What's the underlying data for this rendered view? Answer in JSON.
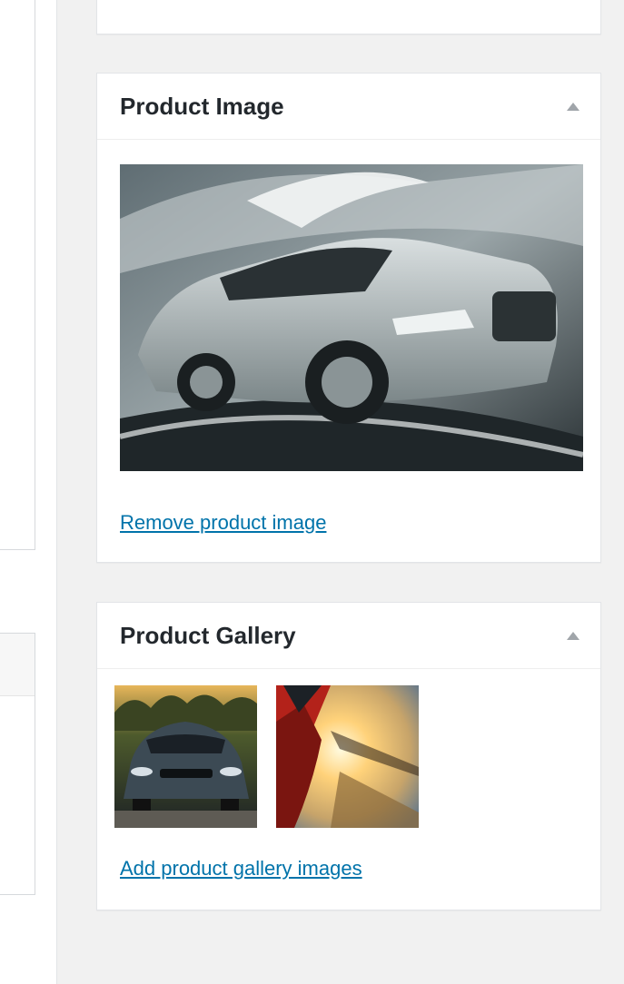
{
  "product_image": {
    "title": "Product Image",
    "toggle_icon": "triangle-up-icon",
    "remove_link": "Remove product image"
  },
  "product_gallery": {
    "title": "Product Gallery",
    "toggle_icon": "triangle-up-icon",
    "add_link": "Add product gallery images"
  },
  "colors": {
    "link": "#0073aa",
    "panel_border": "#e2e4e7",
    "page_bg": "#f1f1f1"
  }
}
